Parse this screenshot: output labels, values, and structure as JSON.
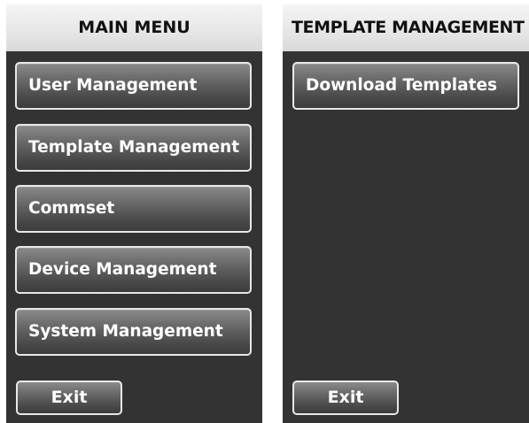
{
  "main_menu": {
    "title": "MAIN MENU",
    "items": [
      {
        "label": "User Management"
      },
      {
        "label": "Template Management"
      },
      {
        "label": "Commset"
      },
      {
        "label": "Device Management"
      },
      {
        "label": "System Management"
      }
    ],
    "exit_label": "Exit"
  },
  "template_management": {
    "title": "TEMPLATE MANAGEMENT",
    "items": [
      {
        "label": "Download Templates"
      }
    ],
    "exit_label": "Exit"
  }
}
